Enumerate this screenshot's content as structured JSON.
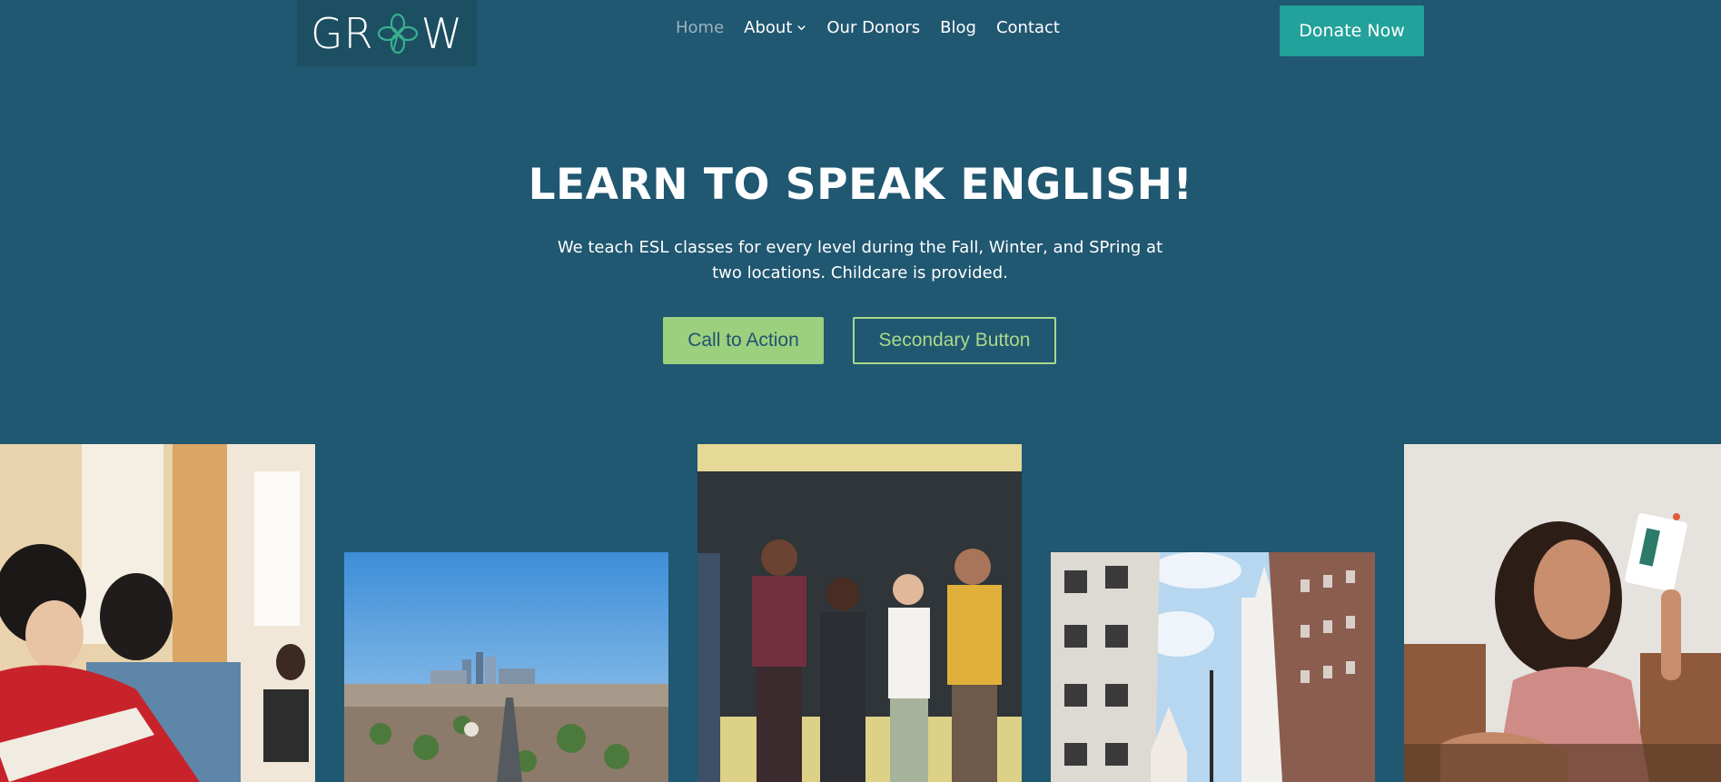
{
  "header": {
    "logo_text_left": "GR",
    "logo_text_right": "W",
    "nav": [
      {
        "label": "Home",
        "active": true
      },
      {
        "label": "About",
        "has_dropdown": true
      },
      {
        "label": "Our Donors"
      },
      {
        "label": "Blog"
      },
      {
        "label": "Contact"
      }
    ],
    "donate_label": "Donate Now"
  },
  "hero": {
    "title": "LEARN TO SPEAK ENGLISH!",
    "subtitle": "We teach ESL classes for every level during the Fall, Winter, and SPring at two locations. Childcare is provided.",
    "primary_button": "Call to Action",
    "secondary_button": "Secondary Button"
  },
  "gallery": [
    {
      "name": "students-reading-photo"
    },
    {
      "name": "city-skyline-photo"
    },
    {
      "name": "group-celebrating-photo"
    },
    {
      "name": "city-hall-buildings-photo"
    },
    {
      "name": "teacher-with-flashcard-photo"
    }
  ],
  "colors": {
    "background": "#205771",
    "accent": "#22a29a",
    "primary_button": "#9ccf7e"
  }
}
